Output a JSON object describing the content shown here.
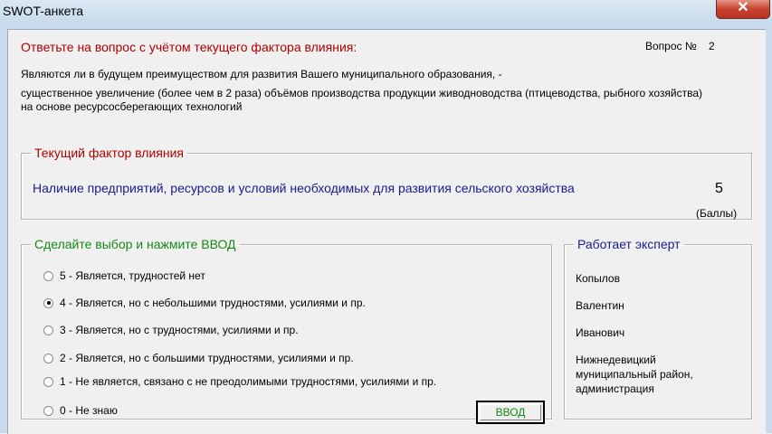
{
  "window": {
    "title": "SWOT-анкета",
    "close_label": "✕"
  },
  "question": {
    "prompt": "Ответьте на вопрос с учётом текущего фактора влияния:",
    "number_label": "Вопрос №",
    "number": "2",
    "lines": [
      "Являются ли в будущем преимуществом для развития Вашего муниципального образования, -",
      "существенное увеличение (более чем в 2 раза) объёмов производства продукции живодноводства (птицеводства, рыбного хозяйства)",
      "на основе ресурсосберегающих технологий"
    ]
  },
  "factor": {
    "legend": "Текущий фактор влияния",
    "text": "Наличие предприятий, ресурсов и условий  необходимых для развития сельского хозяйства",
    "score": "5",
    "unit": "(Баллы)"
  },
  "choice": {
    "legend": "Сделайте выбор и нажмите ВВОД",
    "options": [
      {
        "label": "5 - Является, трудностей нет",
        "selected": false
      },
      {
        "label": "4 - Является, но с небольшими трудностями, усилиями и пр.",
        "selected": true
      },
      {
        "label": "3 - Является, но с трудностями, усилиями и пр.",
        "selected": false
      },
      {
        "label": "2 - Является, но с большими трудностями, усилиями и пр.",
        "selected": false
      },
      {
        "label": "1 - Не является, связано с не преодолимыми трудностями, усилиями и пр.",
        "selected": false
      },
      {
        "label": "0 - Не знаю",
        "selected": false
      }
    ],
    "enter_label": "ВВОД"
  },
  "expert": {
    "legend": "Работает эксперт",
    "last_name": "Копылов",
    "first_name": "Валентин",
    "patronymic": "Иванович",
    "org_lines": [
      "Нижнедевицкий",
      "муниципальный район,",
      "администрация"
    ]
  },
  "colors": {
    "prompt": "#b00000",
    "factor_text": "#1a1a8c",
    "choice_legend": "#138a13",
    "expert_legend": "#1a1a8c"
  }
}
